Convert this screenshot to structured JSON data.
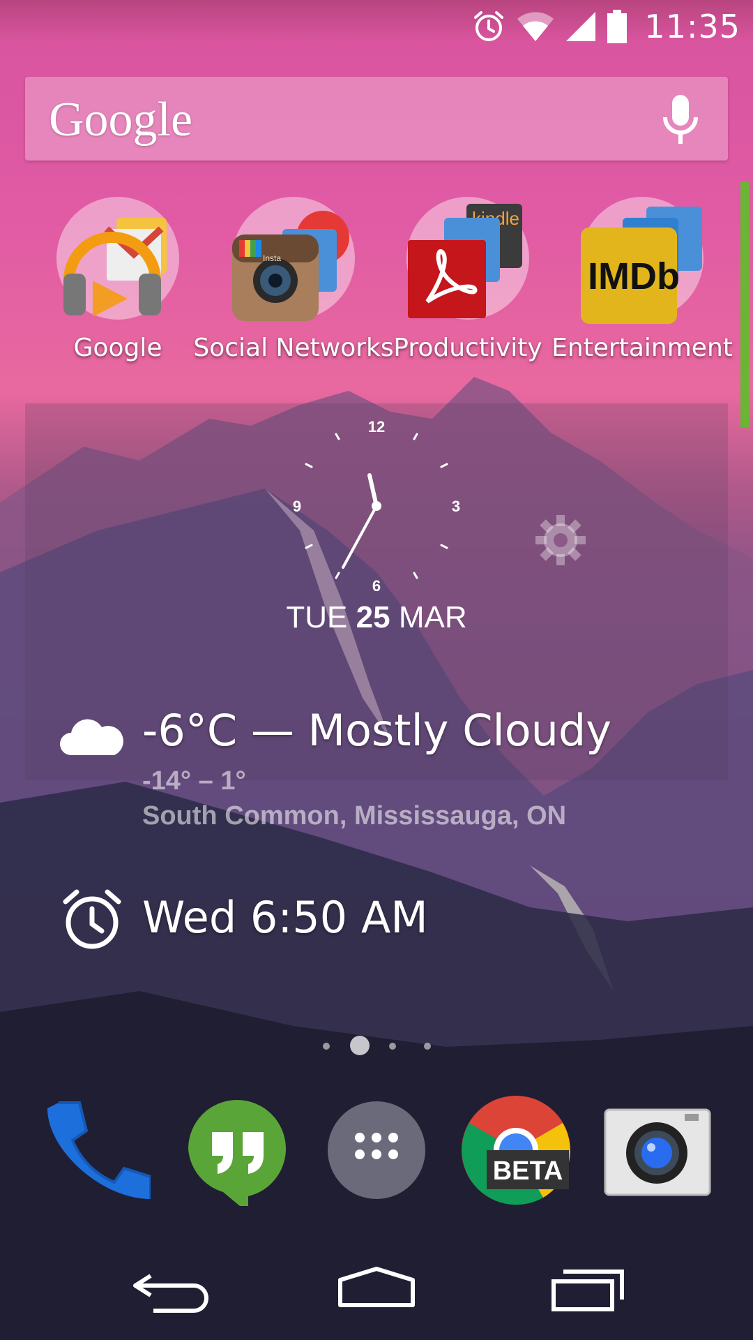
{
  "status_bar": {
    "time": "11:35",
    "icons": [
      "alarm-icon",
      "wifi-icon",
      "signal-icon",
      "battery-icon"
    ]
  },
  "search": {
    "logo": "Google",
    "mic_icon": "mic-icon"
  },
  "folders": [
    {
      "label": "Google"
    },
    {
      "label": "Social Networks"
    },
    {
      "label": "Productivity"
    },
    {
      "label": "Entertainment"
    }
  ],
  "folder_art_text": {
    "instagram": "Insta",
    "kindle": "kindle",
    "imdb": "IMDb"
  },
  "clock": {
    "numerals": [
      "12",
      "3",
      "6",
      "9"
    ],
    "day": "TUE",
    "date": "25",
    "month": "MAR"
  },
  "weather": {
    "current": "-6°C — Mostly Cloudy",
    "range": "-14° – 1°",
    "location": "South Common, Mississauga, ON"
  },
  "alarm": {
    "next": "Wed 6:50 AM"
  },
  "pages": {
    "count": 4,
    "current": 2
  },
  "dock": [
    {
      "name": "Phone"
    },
    {
      "name": "Hangouts"
    },
    {
      "name": "Apps"
    },
    {
      "name": "Chrome Beta",
      "badge": "BETA"
    },
    {
      "name": "Camera"
    }
  ],
  "colors": {
    "page_edge": "#6bb535",
    "hangouts": "#5aa537",
    "phone": "#1d6fdb"
  }
}
